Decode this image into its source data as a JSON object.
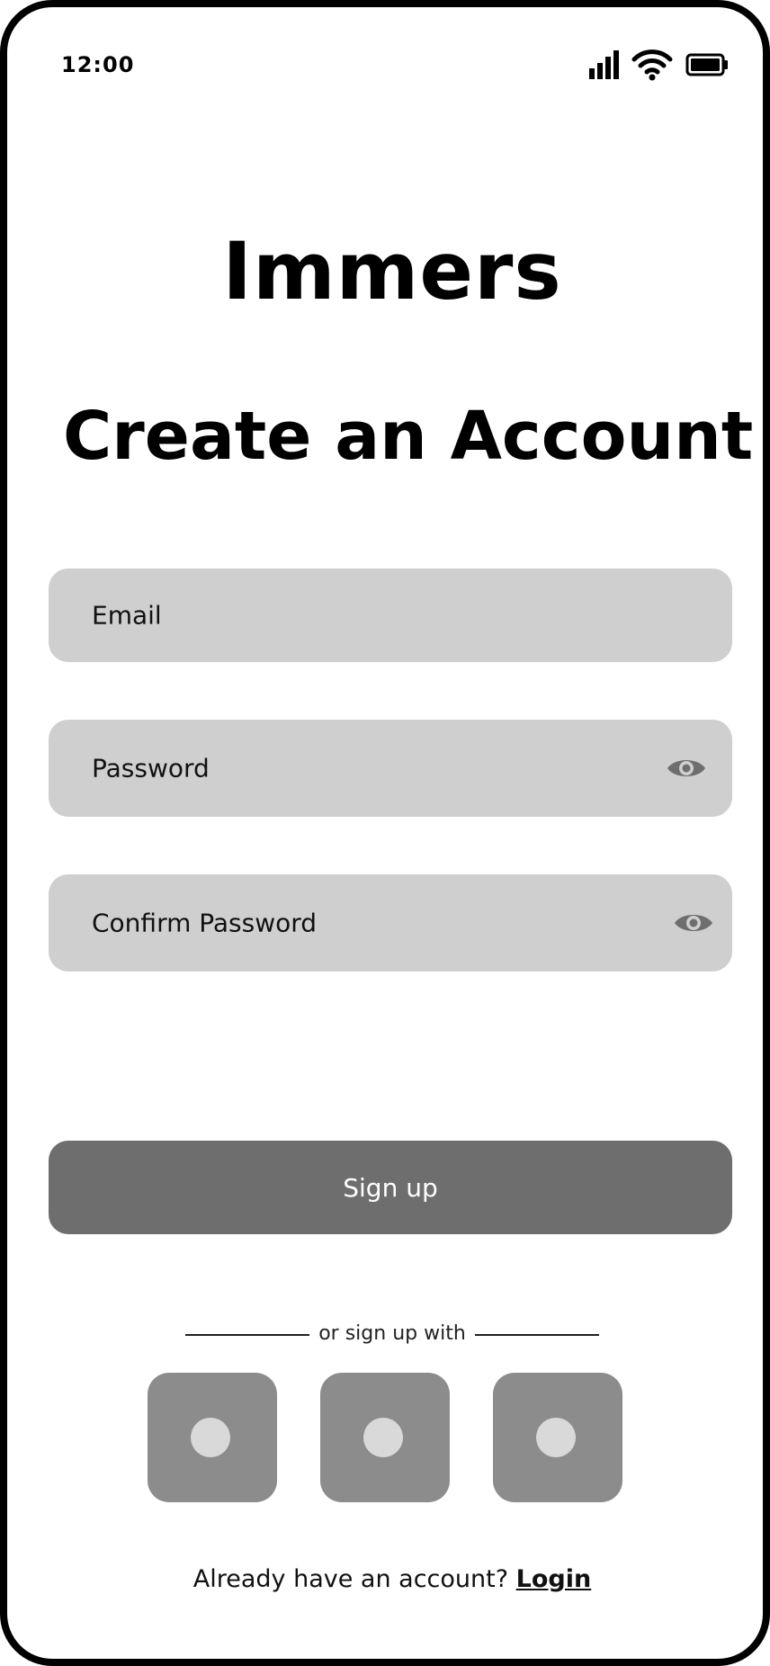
{
  "status_bar": {
    "time": "12:00",
    "icons": [
      "cellular-signal-icon",
      "wifi-icon",
      "battery-icon"
    ]
  },
  "app": {
    "name": "Immers"
  },
  "page": {
    "title": "Create an Account"
  },
  "form": {
    "email_placeholder": "Email",
    "password_placeholder": "Password",
    "confirm_password_placeholder": "Confirm Password",
    "visibility_icon": "eye-icon",
    "submit_label": "Sign up"
  },
  "social": {
    "divider_text": "or sign up with",
    "providers": [
      "provider-1",
      "provider-2",
      "provider-3"
    ]
  },
  "footer": {
    "prompt": "Already have an account?",
    "login_label": "Login"
  },
  "colors": {
    "field_bg": "#cfcfcf",
    "button_bg": "#6e6e6e",
    "social_bg": "#8c8c8c",
    "icon_gray": "#6e6e6e"
  }
}
